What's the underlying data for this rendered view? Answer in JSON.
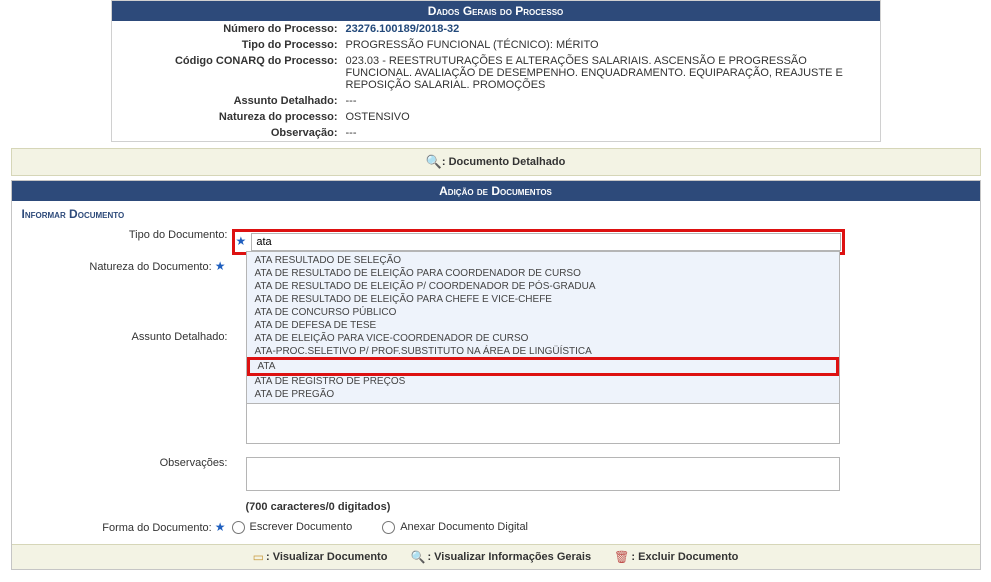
{
  "proc": {
    "title": "Dados Gerais do Processo",
    "lbl_num": "Número do Processo:",
    "val_num": "23276.100189/2018-32",
    "lbl_tipo": "Tipo do Processo:",
    "val_tipo": "PROGRESSÃO FUNCIONAL (TÉCNICO): MÉRITO",
    "lbl_conarq": "Código CONARQ do Processo:",
    "val_conarq": "023.03 - REESTRUTURAÇÕES E ALTERAÇÕES SALARIAIS. ASCENSÃO E PROGRESSÃO FUNCIONAL. AVALIAÇÃO DE DESEMPENHO. ENQUADRAMENTO. EQUIPARAÇÃO, REAJUSTE E REPOSIÇÃO SALARIAL. PROMOÇÕES",
    "lbl_assunto": "Assunto Detalhado:",
    "val_assunto": "---",
    "lbl_natureza": "Natureza do processo:",
    "val_natureza": "OSTENSIVO",
    "lbl_obs": "Observação:",
    "val_obs": "---"
  },
  "docbar": {
    "icon_label": ": Documento Detalhado"
  },
  "adddoc": {
    "title": "Adição de Documentos",
    "subtitle": "Informar Documento",
    "lbl_tipo": "Tipo do Documento:",
    "input_tipo_value": "ata",
    "lbl_natureza": "Natureza do Documento:",
    "lbl_assunto": "Assunto Detalhado:",
    "lbl_obs": "Observações:",
    "char_count": "(700 caracteres/0 digitados)",
    "lbl_forma": "Forma do Documento:",
    "radio1": "Escrever Documento",
    "radio2": "Anexar Documento Digital"
  },
  "suggest": [
    "ATA RESULTADO DE SELEÇÃO",
    "ATA DE RESULTADO DE ELEIÇÃO PARA COORDENADOR DE CURSO",
    "ATA DE RESULTADO DE ELEIÇÃO P/ COORDENADOR DE PÓS-GRADUA",
    "ATA DE RESULTADO DE ELEIÇÃO PARA CHEFE E VICE-CHEFE",
    "ATA DE CONCURSO PÚBLICO",
    "ATA DE DEFESA DE TESE",
    "ATA DE ELEIÇÃO PARA VICE-COORDENADOR DE CURSO",
    "ATA-PROC.SELETIVO P/ PROF.SUBSTITUTO NA ÁREA DE LINGÜÍSTICA",
    "ATA",
    "ATA DE REGISTRO DE PREÇOS",
    "ATA DE PREGÃO"
  ],
  "suggest_selected_index": 8,
  "footer": {
    "view_doc": ": Visualizar Documento",
    "view_info": ": Visualizar Informações Gerais",
    "delete": ": Excluir Documento"
  }
}
